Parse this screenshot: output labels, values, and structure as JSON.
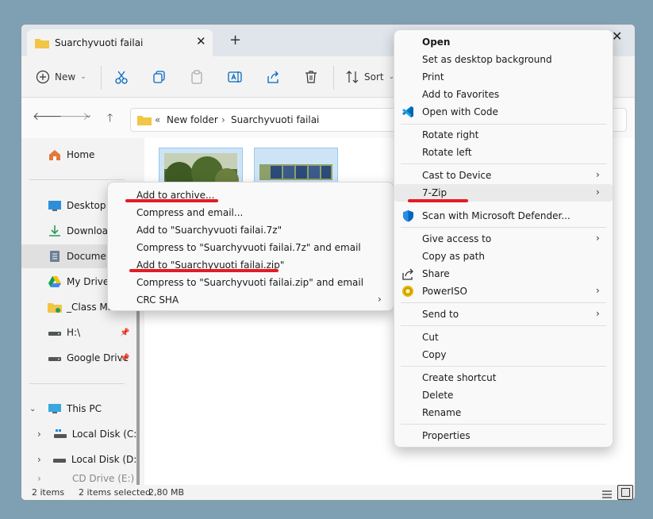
{
  "window": {
    "tab_title": "Suarchyvuoti failai",
    "tab_close": "✕",
    "new_tab": "+",
    "close": "✕"
  },
  "toolbar": {
    "new_label": "New",
    "sort_label": "Sort"
  },
  "address": {
    "overflow": "«",
    "crumbs": [
      "New folder",
      "Suarchyvuoti failai"
    ],
    "separator": "›"
  },
  "sidebar": {
    "home": "Home",
    "items": [
      {
        "label": "Desktop",
        "icon": "desktop-icon"
      },
      {
        "label": "Download",
        "icon": "download-icon"
      },
      {
        "label": "Documen",
        "icon": "documents-icon"
      },
      {
        "label": "My Drive",
        "icon": "google-drive-icon"
      },
      {
        "label": "_Class Mar",
        "icon": "folder-icon"
      },
      {
        "label": "H:\\",
        "icon": "drive-icon"
      },
      {
        "label": "Google Drive",
        "icon": "drive-icon"
      }
    ],
    "this_pc": "This PC",
    "drives": [
      "Local Disk (C:)",
      "Local Disk (D:)",
      "CD Drive (E:)"
    ]
  },
  "statusbar": {
    "count": "2 items",
    "selected": "2 items selected",
    "size": "2,80 MB"
  },
  "context_menu": {
    "groups": [
      [
        "Open",
        "Set as desktop background",
        "Print",
        "Add to Favorites",
        "Open with Code"
      ],
      [
        "Rotate right",
        "Rotate left"
      ],
      [
        "Cast to Device",
        "7-Zip",
        "Scan with Microsoft Defender..."
      ],
      [
        "Give access to",
        "Copy as path",
        "Share",
        "PowerISO"
      ],
      [
        "Send to"
      ],
      [
        "Cut",
        "Copy"
      ],
      [
        "Create shortcut",
        "Delete",
        "Rename"
      ],
      [
        "Properties"
      ]
    ]
  },
  "zip_submenu": {
    "items": [
      "Add to archive...",
      "Compress and email...",
      "Add to \"Suarchyvuoti failai.7z\"",
      "Compress to \"Suarchyvuoti failai.7z\" and email",
      "Add to \"Suarchyvuoti failai.zip\"",
      "Compress to \"Suarchyvuoti failai.zip\" and email",
      "CRC SHA"
    ],
    "submenu_arrow": "›"
  },
  "colors": {
    "highlight_underline": "#e31b23",
    "accent": "#0067c0",
    "folder": "#f2c545"
  }
}
